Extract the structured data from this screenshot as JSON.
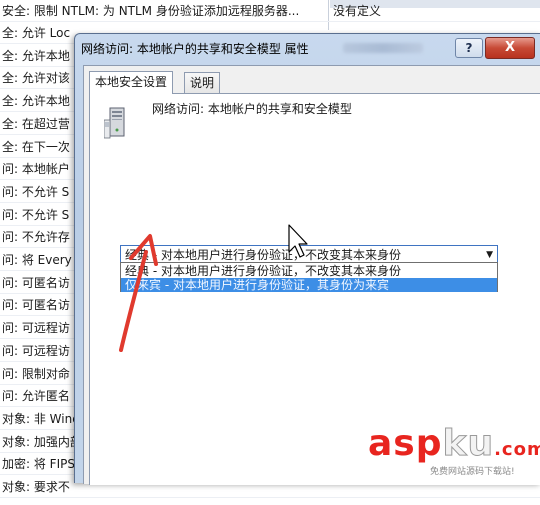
{
  "background": {
    "top_row": {
      "label": "安全: 限制 NTLM: 为 NTLM 身份验证添加远程服务器...",
      "setting": "没有定义"
    },
    "rows": [
      "全: 允许 Loc",
      "全: 允许本地",
      "全: 允许对该",
      "全: 允许本地",
      "全: 在超过营",
      "全: 在下一次",
      "问: 本地帐户",
      "问: 不允许 S",
      "问: 不允许 S",
      "问: 不允许存",
      "问: 将 Every",
      "问: 可匿名访",
      "问: 可匿名访",
      "问: 可远程访",
      "问: 可远程访",
      "问: 限制对命",
      "问: 允许匿名",
      "对象: 非 Wind",
      "对象: 加强内部",
      "加密: 将 FIPS",
      "对象: 要求不"
    ]
  },
  "dialog": {
    "title": "网络访问: 本地帐户的共享和安全模型 属性",
    "help_label": "?",
    "close_label": "X",
    "tabs": [
      "本地安全设置",
      "说明"
    ],
    "policy_name": "网络访问: 本地帐户的共享和安全模型",
    "select": {
      "selected": "经典 - 对本地用户进行身份验证，不改变其本来身份",
      "arrow": "▼",
      "options": [
        "经典 - 对本地用户进行身份验证，不改变其本来身份",
        "仅来宾 - 对本地用户进行身份验证，其身份为来宾"
      ],
      "highlighted_index": 1
    }
  },
  "watermark": {
    "brand_red": "asp",
    "brand_white": "ku",
    "brand_suffix": ".com",
    "subtitle": "免费网站源码下载站!"
  },
  "colors": {
    "highlight": "#3d8ee6",
    "arrow": "#e03a2e",
    "watermark_red": "#e8251f"
  }
}
